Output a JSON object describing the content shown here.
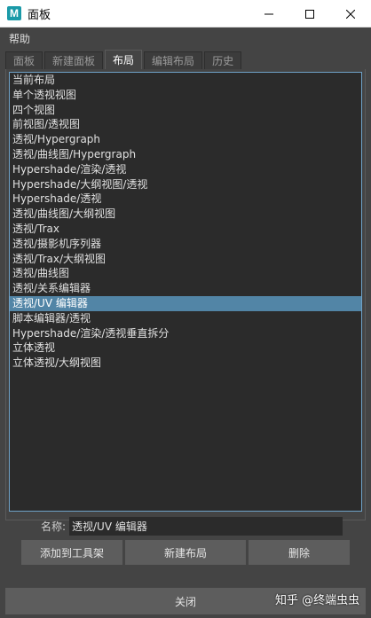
{
  "window": {
    "app_icon_letter": "M",
    "title": "面板"
  },
  "menubar": {
    "help": "帮助"
  },
  "tabs": [
    {
      "label": "面板",
      "active": false
    },
    {
      "label": "新建面板",
      "active": false
    },
    {
      "label": "布局",
      "active": true
    },
    {
      "label": "编辑布局",
      "active": false
    },
    {
      "label": "历史",
      "active": false
    }
  ],
  "layouts": [
    "当前布局",
    "单个透视视图",
    "四个视图",
    "前视图/透视图",
    "透视/Hypergraph",
    "透视/曲线图/Hypergraph",
    "Hypershade/渲染/透视",
    "Hypershade/大纲视图/透视",
    "Hypershade/透视",
    "透视/曲线图/大纲视图",
    "透视/Trax",
    "透视/摄影机序列器",
    "透视/Trax/大纲视图",
    "透视/曲线图",
    "透视/关系编辑器",
    "透视/UV 编辑器",
    "脚本编辑器/透视",
    "Hypershade/渲染/透视垂直拆分",
    "立体透视",
    "立体透视/大纲视图"
  ],
  "selected_index": 15,
  "name_field": {
    "label": "名称:",
    "value": "透视/UV 编辑器"
  },
  "buttons": {
    "add_to_shelf": "添加到工具架",
    "new_layout": "新建布局",
    "delete": "删除"
  },
  "close_label": "关闭",
  "watermark": "知乎 @终端虫虫",
  "colors": {
    "background": "#444444",
    "list_background": "#2b2b2b",
    "selection": "#5285a6",
    "app_icon": "#1a9aa8"
  }
}
